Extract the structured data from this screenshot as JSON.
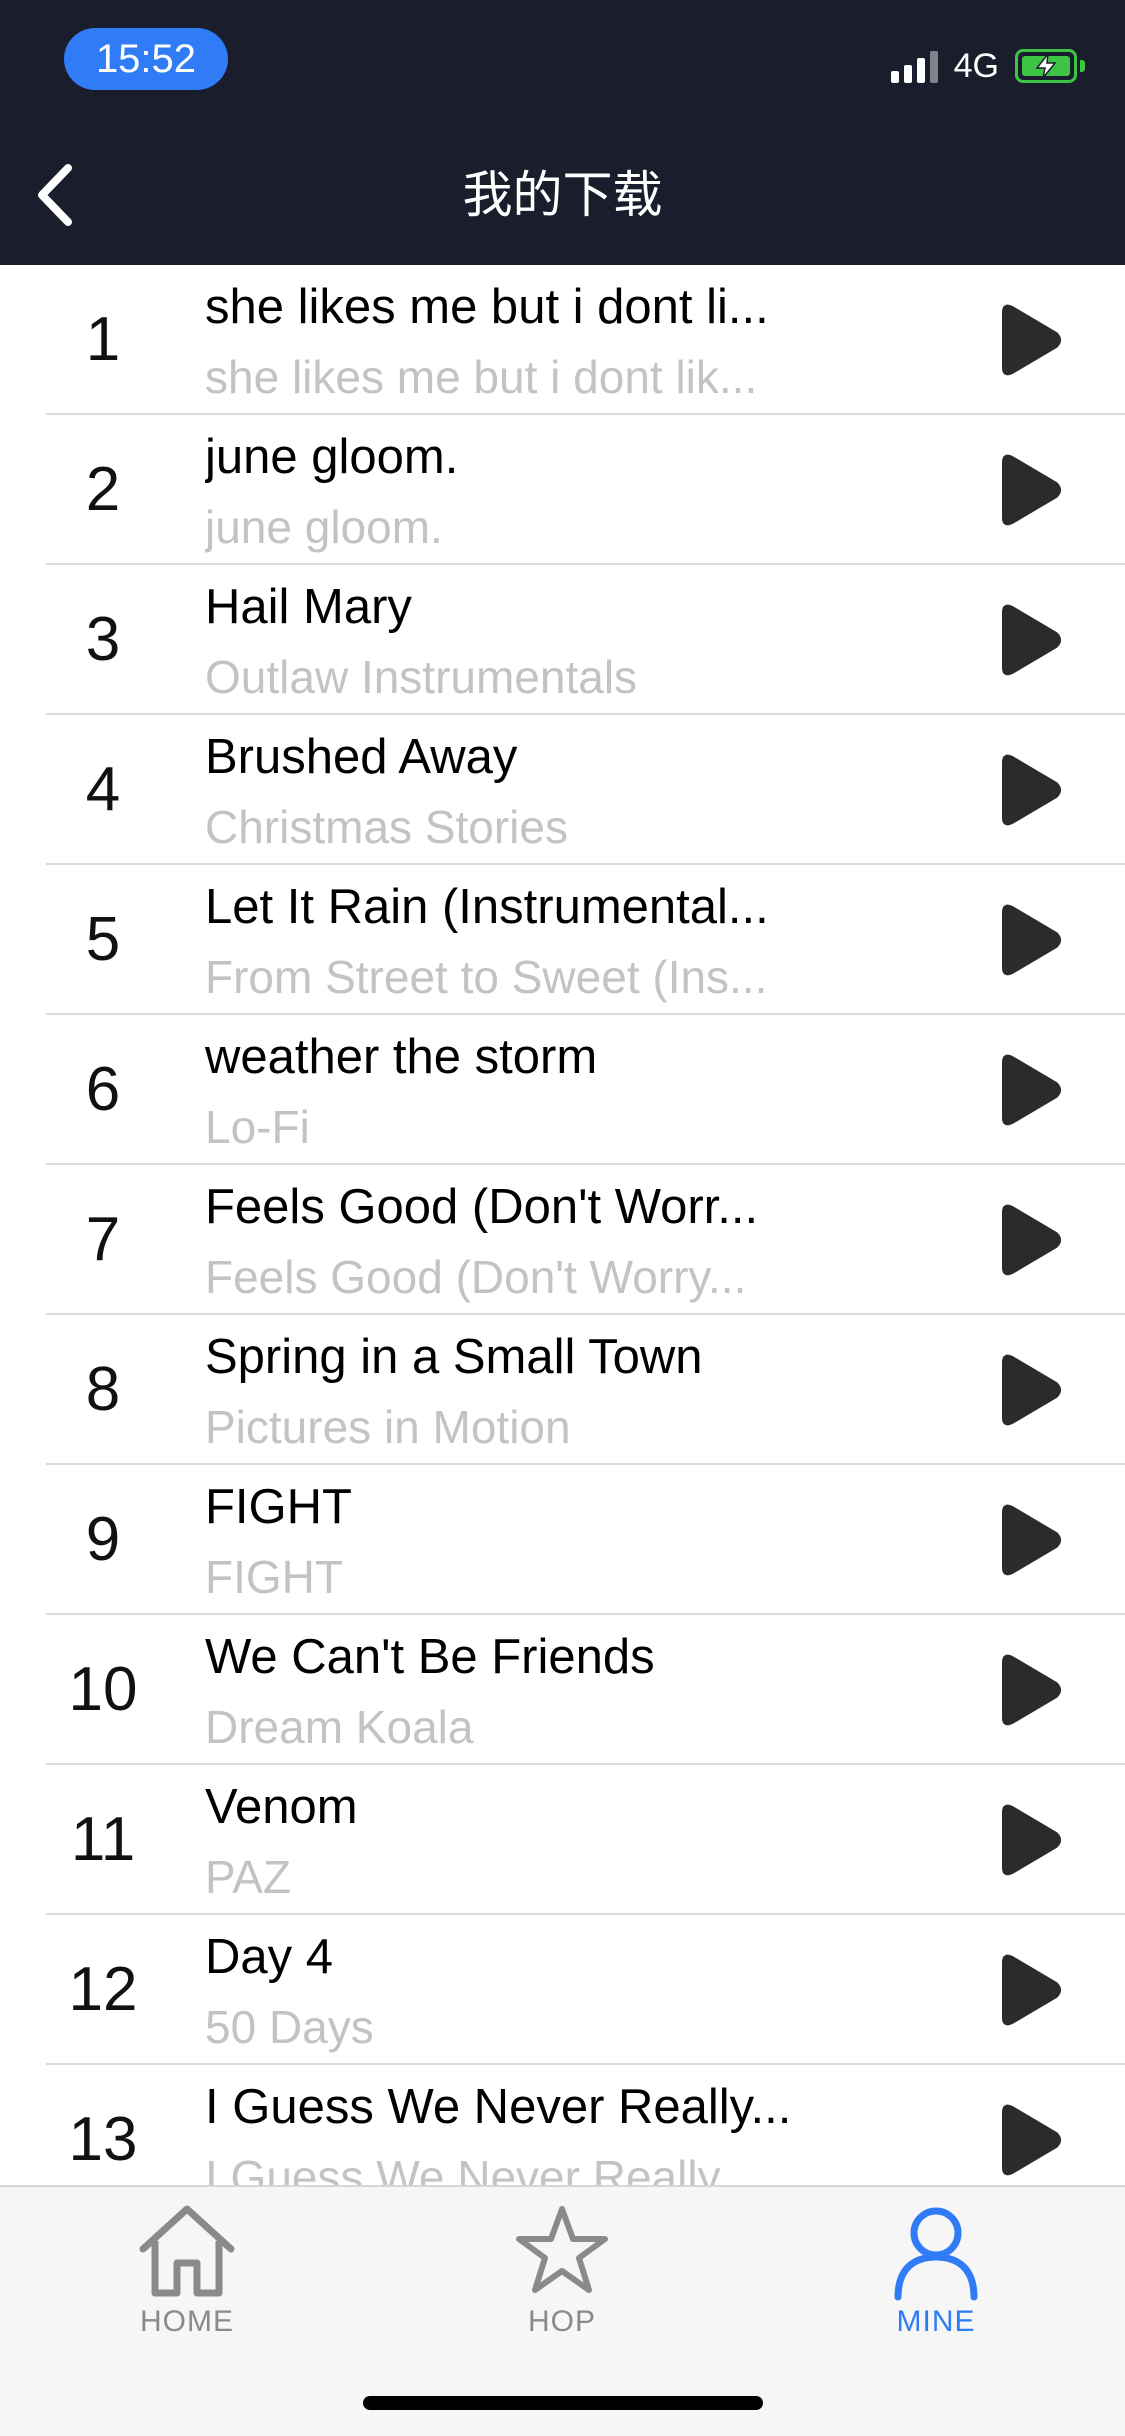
{
  "status_bar": {
    "time": "15:52",
    "network": "4G",
    "signal_icon": "signal-bars-icon",
    "battery_icon": "battery-charging-icon"
  },
  "nav": {
    "title": "我的下载",
    "back_icon": "chevron-left-icon"
  },
  "songs": [
    {
      "index": "1",
      "title": "she likes me but i dont li...",
      "subtitle": "she likes me but i dont lik..."
    },
    {
      "index": "2",
      "title": "june gloom.",
      "subtitle": "june gloom."
    },
    {
      "index": "3",
      "title": "Hail Mary",
      "subtitle": "Outlaw Instrumentals"
    },
    {
      "index": "4",
      "title": "Brushed Away",
      "subtitle": "Christmas Stories"
    },
    {
      "index": "5",
      "title": "Let It Rain (Instrumental...",
      "subtitle": "From Street to Sweet (Ins..."
    },
    {
      "index": "6",
      "title": "weather the storm",
      "subtitle": "Lo-Fi"
    },
    {
      "index": "7",
      "title": "Feels Good (Don't Worr...",
      "subtitle": "Feels Good (Don't Worry..."
    },
    {
      "index": "8",
      "title": "Spring in a Small Town",
      "subtitle": "Pictures in Motion"
    },
    {
      "index": "9",
      "title": "FIGHT",
      "subtitle": "FIGHT"
    },
    {
      "index": "10",
      "title": "We Can't Be Friends",
      "subtitle": "Dream Koala"
    },
    {
      "index": "11",
      "title": "Venom",
      "subtitle": "PAZ"
    },
    {
      "index": "12",
      "title": "Day 4",
      "subtitle": "50 Days"
    },
    {
      "index": "13",
      "title": "I Guess We Never Really...",
      "subtitle": "I Guess We Never Really..."
    }
  ],
  "tabbar": {
    "tabs": [
      {
        "label": "HOME",
        "icon": "house-icon",
        "active": false
      },
      {
        "label": "HOP",
        "icon": "star-icon",
        "active": false
      },
      {
        "label": "MINE",
        "icon": "person-icon",
        "active": true
      }
    ]
  },
  "colors": {
    "header_bg": "#1a1d2b",
    "accent": "#2f7cf6",
    "battery": "#3ec444",
    "inactive_tab": "#8a8a8a",
    "subtitle": "#c3c3c3"
  }
}
